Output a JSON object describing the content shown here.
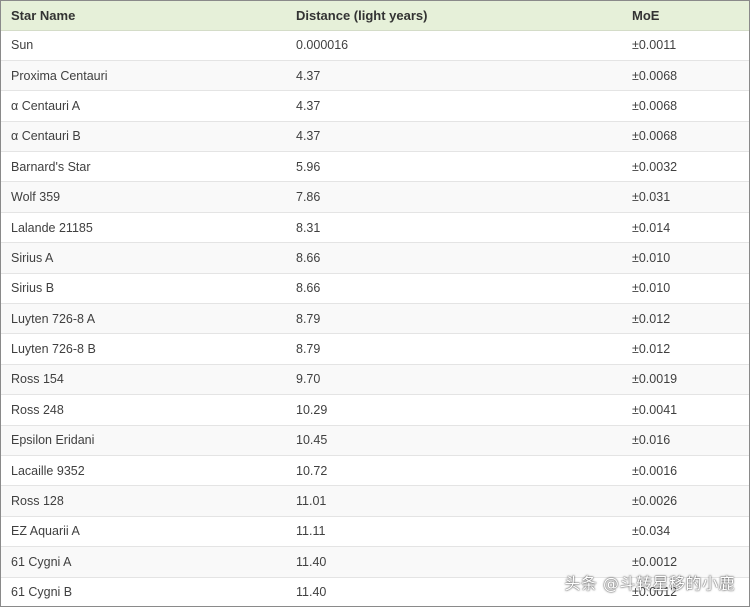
{
  "table": {
    "headers": [
      "Star Name",
      "Distance (light years)",
      "MoE"
    ],
    "rows": [
      [
        "Sun",
        "0.000016",
        "±0.0011"
      ],
      [
        "Proxima Centauri",
        "4.37",
        "±0.0068"
      ],
      [
        "α Centauri A",
        "4.37",
        "±0.0068"
      ],
      [
        "α Centauri B",
        "4.37",
        "±0.0068"
      ],
      [
        "Barnard's Star",
        "5.96",
        "±0.0032"
      ],
      [
        "Wolf 359",
        "7.86",
        "±0.031"
      ],
      [
        "Lalande 21185",
        "8.31",
        "±0.014"
      ],
      [
        "Sirius A",
        "8.66",
        "±0.010"
      ],
      [
        "Sirius B",
        "8.66",
        "±0.010"
      ],
      [
        "Luyten 726-8 A",
        "8.79",
        "±0.012"
      ],
      [
        "Luyten 726-8 B",
        "8.79",
        "±0.012"
      ],
      [
        "Ross 154",
        "9.70",
        "±0.0019"
      ],
      [
        "Ross 248",
        "10.29",
        "±0.0041"
      ],
      [
        "Epsilon Eridani",
        "10.45",
        "±0.016"
      ],
      [
        "Lacaille 9352",
        "10.72",
        "±0.0016"
      ],
      [
        "Ross 128",
        "11.01",
        "±0.0026"
      ],
      [
        "EZ Aquarii A",
        "11.11",
        "±0.034"
      ],
      [
        "61 Cygni A",
        "11.40",
        "±0.0012"
      ],
      [
        "61 Cygni B",
        "11.40",
        "±0.0012"
      ]
    ]
  },
  "watermark": {
    "text": "头条 @斗转星移的小鹿"
  },
  "colors": {
    "header_bg": "#e6f0d9",
    "row_alt_bg": "#f9f9f9",
    "border": "#e4e4e4"
  }
}
